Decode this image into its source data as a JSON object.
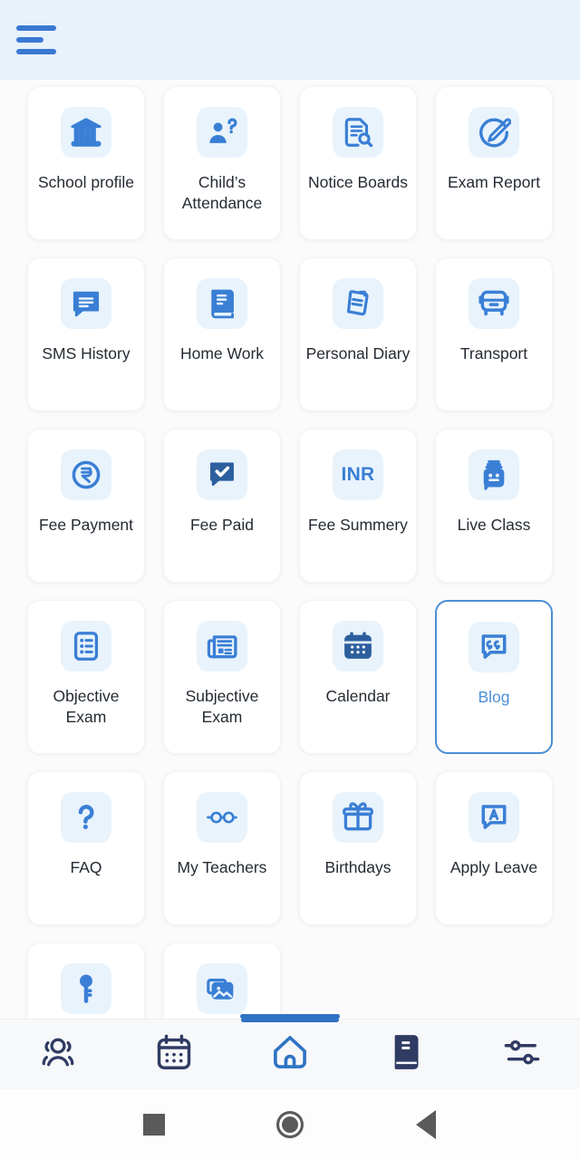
{
  "app": {
    "background_color": "#fbfbfb",
    "accent_color": "#3a78d2",
    "icon_tile_color": "#e8f3fc",
    "header_color": "#e7f2fb"
  },
  "header": {
    "menu_label": "Menu"
  },
  "grid": {
    "items": [
      {
        "label": "School\nprofile",
        "icon": "bank-icon",
        "selected": false
      },
      {
        "label": "Child’s\nAttendance",
        "icon": "person-question-icon",
        "selected": false
      },
      {
        "label": "Notice\nBoards",
        "icon": "document-search-icon",
        "selected": false
      },
      {
        "label": "Exam\nReport",
        "icon": "pencil-circle-icon",
        "selected": false
      },
      {
        "label": "SMS\nHistory",
        "icon": "chat-lines-icon",
        "selected": false
      },
      {
        "label": "Home\nWork",
        "icon": "book-icon",
        "selected": false
      },
      {
        "label": "Personal\nDiary",
        "icon": "diary-icon",
        "selected": false
      },
      {
        "label": "Transport",
        "icon": "bus-icon",
        "selected": false
      },
      {
        "label": "Fee\nPayment",
        "icon": "rupee-circle-icon",
        "selected": false
      },
      {
        "label": "Fee Paid",
        "icon": "chat-check-icon",
        "selected": false
      },
      {
        "label": "Fee\nSummery",
        "icon": "inr-text-icon",
        "icon_text": "INR",
        "selected": false
      },
      {
        "label": "Live Class",
        "icon": "live-class-icon",
        "selected": false
      },
      {
        "label": "Objective\nExam",
        "icon": "checklist-icon",
        "selected": false
      },
      {
        "label": "Subjective\nExam",
        "icon": "news-icon",
        "selected": false
      },
      {
        "label": "Calendar",
        "icon": "calendar-icon",
        "selected": false
      },
      {
        "label": "Blog",
        "icon": "chat-quote-icon",
        "selected": true
      },
      {
        "label": "FAQ",
        "icon": "question-mark-icon",
        "selected": false
      },
      {
        "label": "My\nTeachers",
        "icon": "glasses-icon",
        "selected": false
      },
      {
        "label": "Birthdays",
        "icon": "gift-icon",
        "selected": false
      },
      {
        "label": "Apply\nLeave",
        "icon": "chat-letter-a-icon",
        "selected": false
      },
      {
        "label": "",
        "icon": "key-icon",
        "selected": false
      },
      {
        "label": "",
        "icon": "photos-icon",
        "selected": false
      }
    ]
  },
  "bottom_nav": {
    "items": [
      {
        "icon": "users-group-icon",
        "active": false
      },
      {
        "icon": "calendar-icon",
        "active": false
      },
      {
        "icon": "home-icon",
        "active": true
      },
      {
        "icon": "book-icon",
        "active": false
      },
      {
        "icon": "sliders-settings-icon",
        "active": false
      }
    ]
  },
  "system_nav": {
    "items": [
      {
        "icon": "recents-square-icon"
      },
      {
        "icon": "home-circle-icon"
      },
      {
        "icon": "back-triangle-icon"
      }
    ]
  }
}
